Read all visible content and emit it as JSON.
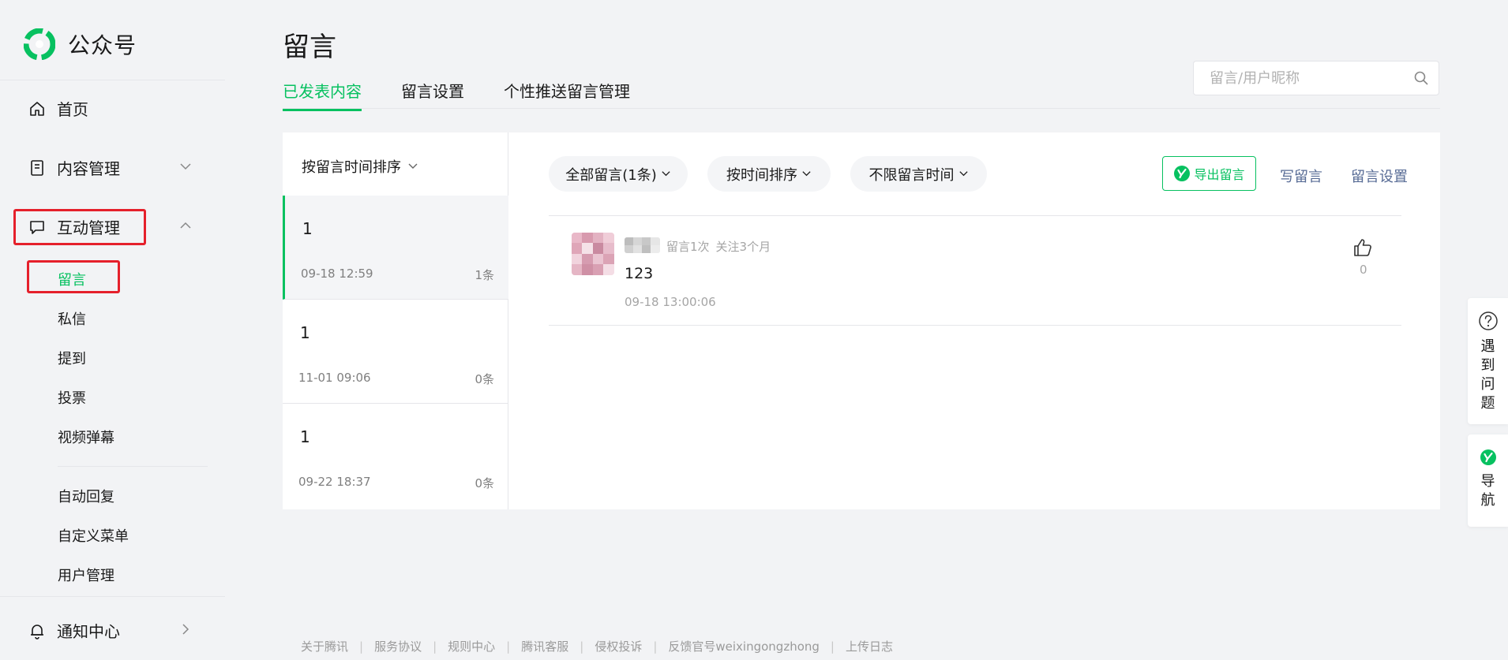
{
  "brand": {
    "title": "公众号"
  },
  "sidebar": {
    "home": "首页",
    "content_mgmt": "内容管理",
    "interaction_mgmt": "互动管理",
    "sub_items": [
      "留言",
      "私信",
      "提到",
      "投票",
      "视频弹幕"
    ],
    "sub_items2": [
      "自动回复",
      "自定义菜单",
      "用户管理"
    ],
    "notifications": "通知中心"
  },
  "page": {
    "title": "留言",
    "tabs": [
      "已发表内容",
      "留言设置",
      "个性推送留言管理"
    ],
    "search_placeholder": "留言/用户昵称"
  },
  "article_list": {
    "sort_label": "按留言时间排序",
    "items": [
      {
        "title": "1",
        "time": "09-18 12:59",
        "count": "1条"
      },
      {
        "title": "1",
        "time": "11-01 09:06",
        "count": "0条"
      },
      {
        "title": "1",
        "time": "09-22 18:37",
        "count": "0条"
      }
    ]
  },
  "filters": {
    "all": "全部留言(1条)",
    "sort": "按时间排序",
    "time": "不限留言时间"
  },
  "actions": {
    "export": "导出留言",
    "write": "写留言",
    "settings": "留言设置"
  },
  "comment": {
    "count_info": "留言1次",
    "follow_info": "关注3个月",
    "text": "123",
    "time": "09-18 13:00:06",
    "likes": "0"
  },
  "help": {
    "problem": "遇到问题",
    "nav": "导航"
  },
  "footer": {
    "links": [
      "关于腾讯",
      "服务协议",
      "规则中心",
      "腾讯客服",
      "侵权投诉",
      "反馈官号weixingongzhong",
      "上传日志"
    ]
  },
  "colors": {
    "accent": "#07c160",
    "link": "#576b95",
    "highlight": "#e5202b",
    "background": "#f2f3f5"
  }
}
